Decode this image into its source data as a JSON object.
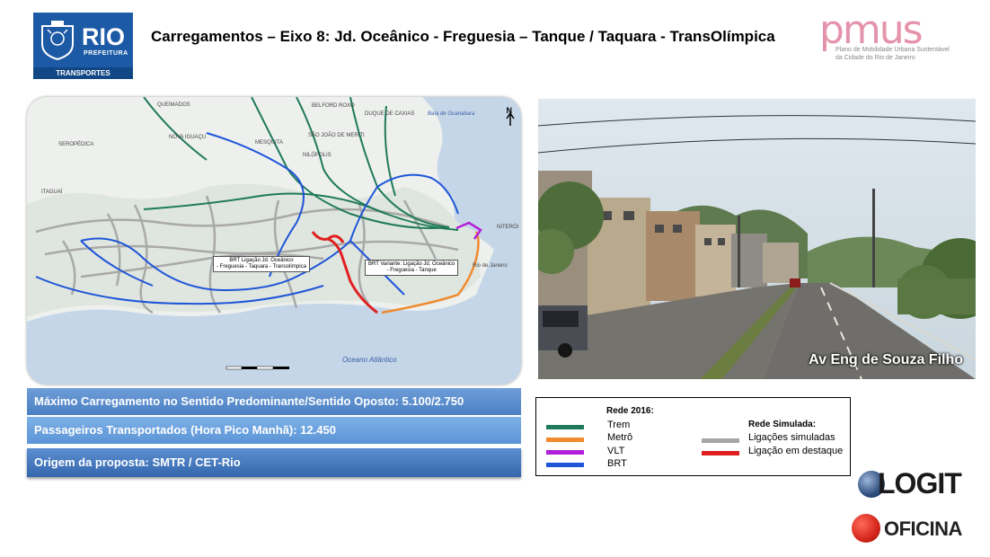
{
  "header": {
    "logo_rio": "RIO",
    "logo_prefeitura": "PREFEITURA",
    "logo_transportes": "TRANSPORTES",
    "title": "Carregamentos – Eixo 8: Jd. Oceânico - Freguesia – Tanque / Taquara - TransOlímpica",
    "pmus_word": "pmus",
    "pmus_sub1": "Plano de Mobilidade Urbana Sustentável",
    "pmus_sub2": "da Cidade do Rio de Janeiro"
  },
  "map": {
    "place_labels": [
      "QUEIMADOS",
      "BELFORD ROXO",
      "DUQUE DE CAXIAS",
      "SEROPÉDICA",
      "NOVA IGUAÇU",
      "MESQUITA",
      "SÃO JOÃO DE MERITI",
      "NILÓPOLIS",
      "ITAGUAÍ",
      "NITERÓI",
      "Rio de Janeiro"
    ],
    "bay": "Baía de Guanabara",
    "ocean": "Oceano Atlântico",
    "north": "N",
    "callout1_line1": "BRT Ligação Jd. Oceânico",
    "callout1_line2": "- Freguesia - Taquara - Transolímpica",
    "callout2_line1": "BRT Variante: Ligação Jd. Oceânico",
    "callout2_line2": "- Freguesia - Tanque"
  },
  "photo": {
    "caption": "Av Eng de Souza Filho"
  },
  "info": {
    "max_load": "Máximo Carregamento no Sentido Predominante/Sentido Oposto: 5.100/2.750",
    "passengers": "Passageiros Transportados (Hora Pico Manhã): 12.450",
    "origin": "Origem da proposta: SMTR /  CET-Rio"
  },
  "legend": {
    "rede2016_title": "Rede 2016:",
    "items_2016": [
      {
        "label": "Trem",
        "color": "#1f7a5a"
      },
      {
        "label": "Metrô",
        "color": "#f08a2c"
      },
      {
        "label": "VLT",
        "color": "#b21fd8"
      },
      {
        "label": "BRT",
        "color": "#1f55d8"
      }
    ],
    "simulada_title": "Rede Simulada:",
    "items_simulada": [
      {
        "label": "Ligações simuladas",
        "color": "#a6a6a6"
      },
      {
        "label": "Ligação em destaque",
        "color": "#e02020"
      }
    ]
  },
  "logos": {
    "logit": "LOGIT",
    "oficina": "OFICINA"
  }
}
